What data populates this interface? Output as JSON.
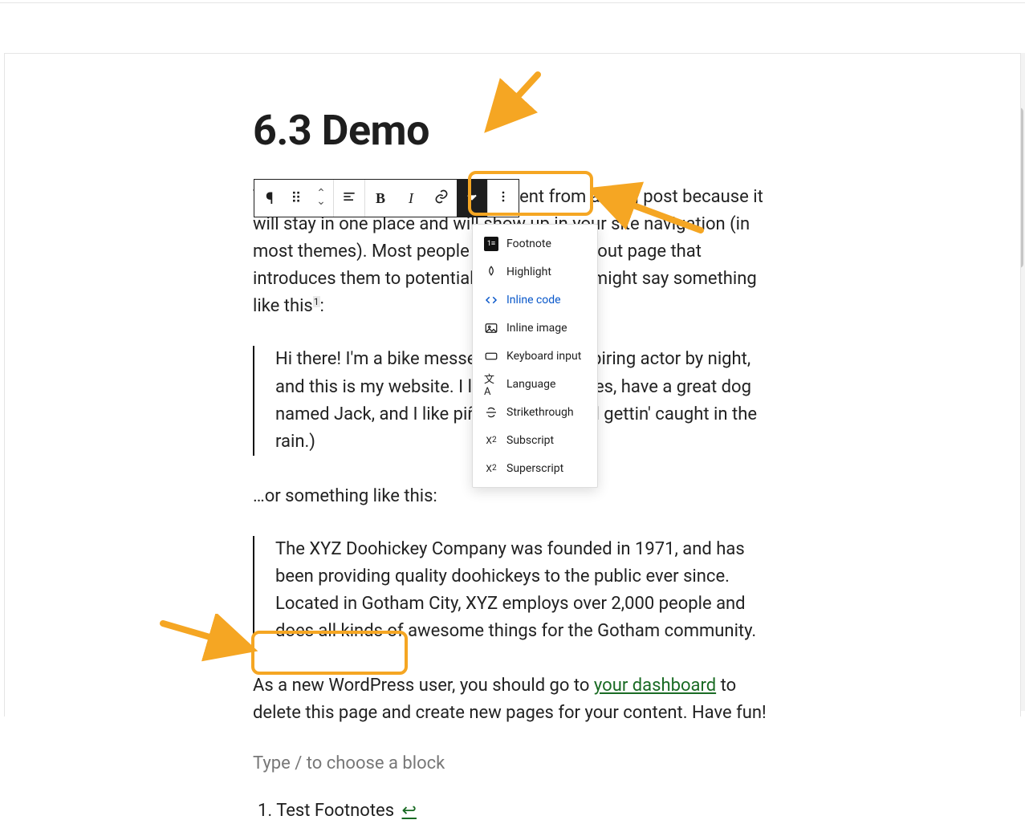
{
  "title": "6.3 Demo",
  "toolbar": {
    "paragraph_icon": "paragraph",
    "drag_icon": "drag",
    "mover_icon": "mover",
    "align_icon": "align-left",
    "bold": "B",
    "italic": "I",
    "link_icon": "link",
    "more_format_icon": "chevron-down",
    "overflow_icon": "more-vertical"
  },
  "dropdown": {
    "items": [
      {
        "label": "Footnote",
        "icon": "footnote"
      },
      {
        "label": "Highlight",
        "icon": "highlight"
      },
      {
        "label": "Inline code",
        "icon": "code",
        "linklike": true
      },
      {
        "label": "Inline image",
        "icon": "image"
      },
      {
        "label": "Keyboard input",
        "icon": "keyboard"
      },
      {
        "label": "Language",
        "icon": "language"
      },
      {
        "label": "Strikethrough",
        "icon": "strike"
      },
      {
        "label": "Subscript",
        "icon": "subscript"
      },
      {
        "label": "Superscript",
        "icon": "superscript"
      }
    ]
  },
  "body": {
    "p1_a": "This is an example page. It's different from a blog post because it will stay in one place and will show up in your site navigation (in most themes). Most people start with an About page that introduces them to potential site visitors. It might say something like this",
    "p1_sup": "1",
    "p1_b": ":",
    "bq1": "Hi there! I'm a bike messenger by day, aspiring actor by night, and this is my website. I live in Los Angeles, have a great dog named Jack, and I like piña coladas. (And gettin' caught in the rain.)",
    "p2": "…or something like this:",
    "bq2": "The XYZ Doohickey Company was founded in 1971, and has been providing quality doohickeys to the public ever since. Located in Gotham City, XYZ employs over 2,000 people and does all kinds of awesome things for the Gotham community.",
    "p3_a": "As a new WordPress user, you should go to ",
    "p3_link": "your dashboard",
    "p3_b": " to delete this page and create new pages for your content. Have fun!",
    "placeholder": "Type / to choose a block",
    "footnote_text": "1. Test Footnotes ",
    "footnote_return": "↩"
  }
}
